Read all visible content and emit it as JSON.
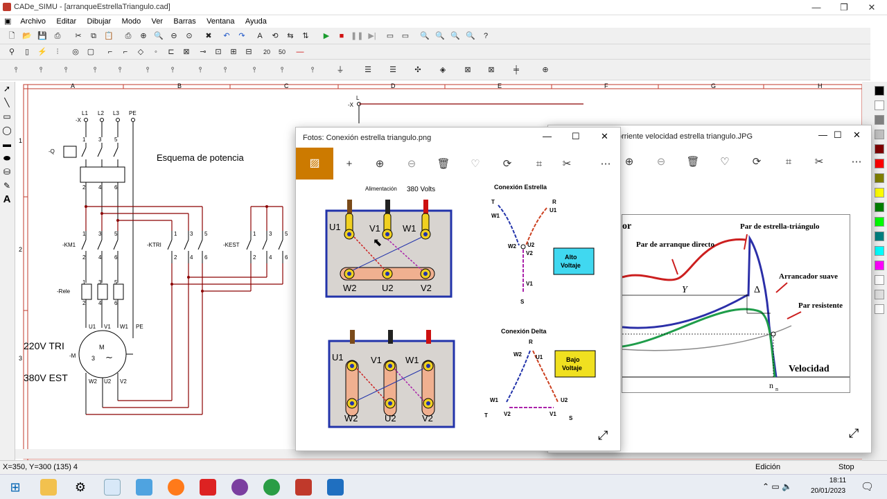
{
  "app": {
    "title": "CADe_SIMU - [arranqueEstrellaTriangulo.cad]"
  },
  "menu": [
    "Archivo",
    "Editar",
    "Dibujar",
    "Modo",
    "Ver",
    "Barras",
    "Ventana",
    "Ayuda"
  ],
  "schematic": {
    "columns": [
      "A",
      "B",
      "C",
      "D",
      "E",
      "F",
      "G",
      "H"
    ],
    "rows": [
      "1",
      "2",
      "3"
    ],
    "title": "Esquema de potencia",
    "phases": [
      "L1",
      "L2",
      "L3",
      "PE"
    ],
    "prefix_x": "-X",
    "q": "-Q",
    "km1": "-KM1",
    "ktri": "-KTRI",
    "kest": "-KEST",
    "rele": "-Rele",
    "m": "-M",
    "term_top": [
      "1",
      "3",
      "5"
    ],
    "term_bot": [
      "2",
      "4",
      "6"
    ],
    "motor_terms_top": [
      "U1",
      "V1",
      "W1",
      "PE"
    ],
    "motor_terms_bot": [
      "W2",
      "U2",
      "V2"
    ],
    "motor_m": "M",
    "motor_3": "3",
    "note1": "220V TRI",
    "note2": "380V EST",
    "l_label": "L"
  },
  "photo1": {
    "title": "Fotos: Conexión estrella triangulo.png",
    "alimentacion": "Alimentación",
    "volts": "380 Volts",
    "conn_estrella": "Conexión Estrella",
    "conn_delta": "Conexión Delta",
    "alto": [
      "Alto",
      "Voltaje"
    ],
    "bajo": [
      "Bajo",
      "Voltaje"
    ],
    "top_terms": [
      "U1",
      "V1",
      "W1"
    ],
    "bot_terms": [
      "W2",
      "U2",
      "V2"
    ],
    "star_labels": {
      "T": "T",
      "W1": "W1",
      "R": "R",
      "U1": "U1",
      "W2": "W2",
      "U2": "U2",
      "V2": "V2",
      "V1": "V1",
      "S": "S"
    },
    "delta_labels": {
      "R": "R",
      "W2": "W2",
      "U1": "U1",
      "W1": "W1",
      "U2": "U2",
      "T": "T",
      "V2": "V2",
      "V1": "V1",
      "S": "S"
    }
  },
  "photo2": {
    "title": "orriente velocidad estrella triangulo.JPG",
    "labels": [
      "Par de estrella-triángulo",
      "Par de arranque directo",
      "Arrancador suave",
      "Par resistente",
      "Velocidad",
      "Y",
      "Δ",
      "n",
      "n",
      "or"
    ]
  },
  "status": {
    "coords": "X=350, Y=300 (135) 4",
    "mode": "Edición",
    "state": "Stop"
  },
  "clock": {
    "time": "18:11",
    "date": "20/01/2023"
  },
  "colors": {
    "wire": "#8b0000",
    "accent": "#cc7a00",
    "graph_red": "#cc1f1f",
    "graph_blue": "#2b2fa8",
    "graph_green": "#1f9d4a"
  }
}
